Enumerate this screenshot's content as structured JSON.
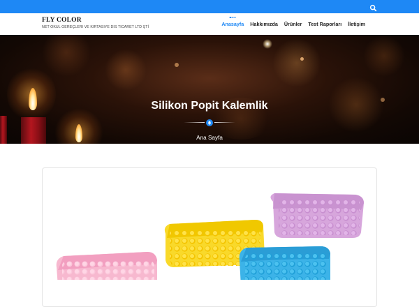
{
  "topbar": {
    "search_icon": "search-icon",
    "color": "#1e88f5"
  },
  "brand": {
    "title": "FLY COLOR",
    "subtitle": "NET OKUL GEREÇLERI VE KIRTASIYE DIS TICARET LTD ŞTİ"
  },
  "nav": {
    "items": [
      {
        "label": "Anasayfa",
        "active": true
      },
      {
        "label": "Hakkımızda"
      },
      {
        "label": "Ürünler"
      },
      {
        "label": "Test Raporları"
      },
      {
        "label": "İletişim"
      }
    ]
  },
  "hero": {
    "title": "Silikon Popit Kalemlik",
    "breadcrumb": "Ana Sayfa",
    "divider_icon": "bell-icon"
  },
  "product": {
    "image": "popit-pencil-cases-image",
    "colors": [
      "#f7b8cf",
      "#f9d92a",
      "#d7a6dc",
      "#3cb3e8"
    ]
  }
}
